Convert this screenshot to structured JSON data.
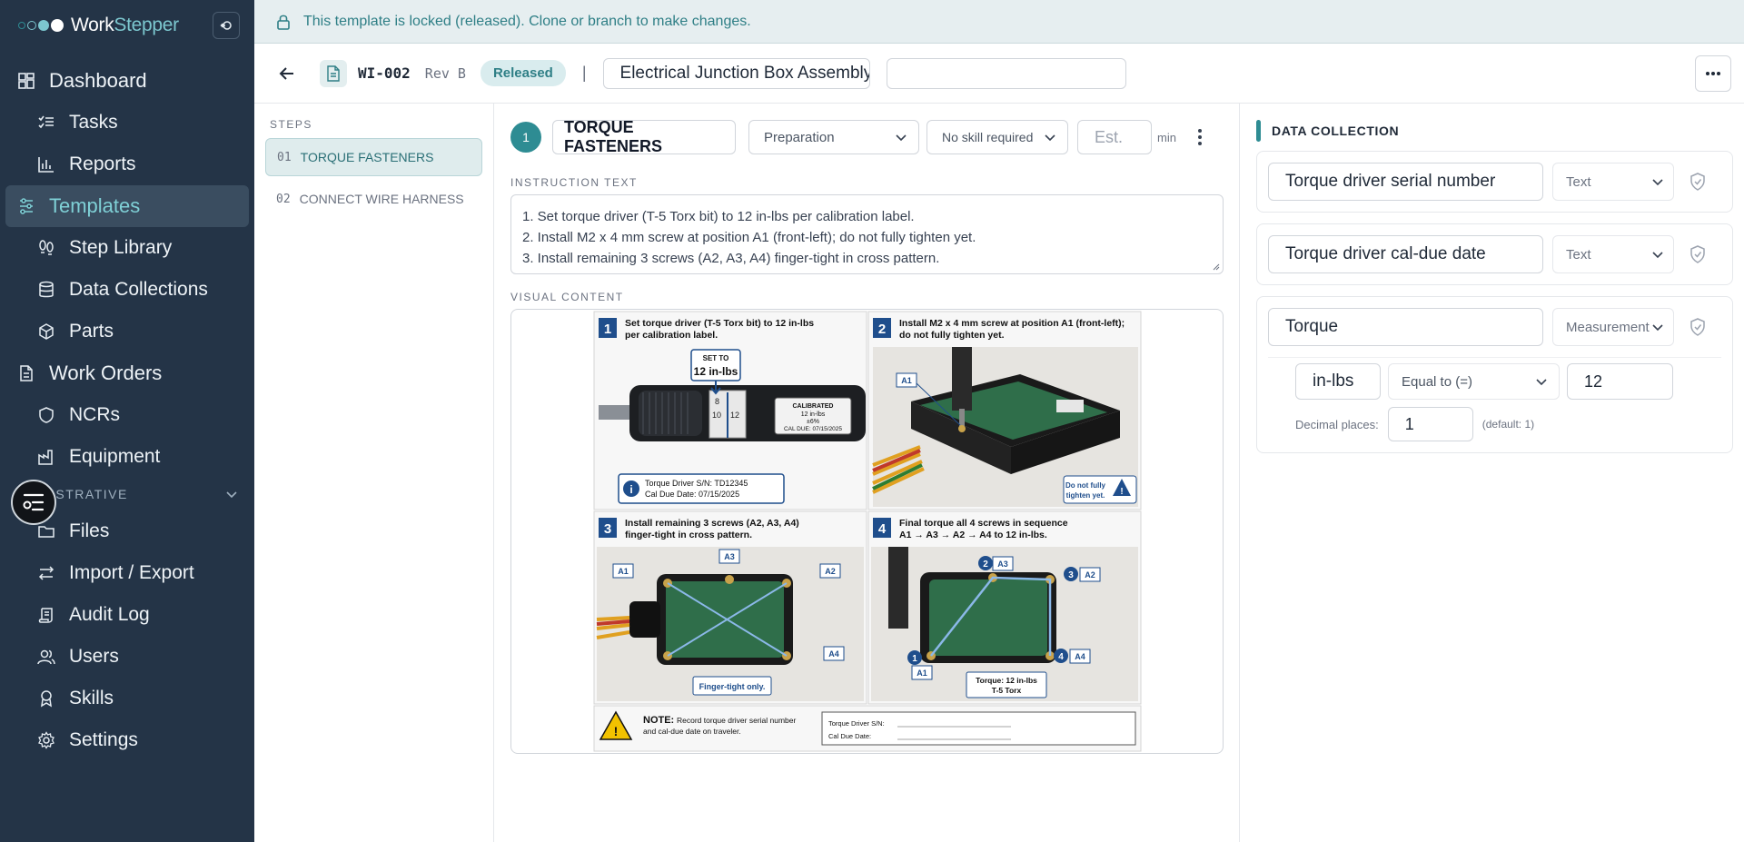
{
  "app": {
    "name_part1": "Work",
    "name_part2": "Stepper"
  },
  "sidebar": {
    "items": [
      {
        "label": "Dashboard"
      },
      {
        "label": "Tasks"
      },
      {
        "label": "Reports"
      },
      {
        "label": "Templates"
      },
      {
        "label": "Step Library"
      },
      {
        "label": "Data Collections"
      },
      {
        "label": "Parts"
      },
      {
        "label": "Work Orders"
      },
      {
        "label": "NCRs"
      },
      {
        "label": "Equipment"
      },
      {
        "label": "Files"
      },
      {
        "label": "Import / Export"
      },
      {
        "label": "Audit Log"
      },
      {
        "label": "Users"
      },
      {
        "label": "Skills"
      },
      {
        "label": "Settings"
      }
    ],
    "section_label": "ISTRATIVE",
    "active_item": "Templates"
  },
  "banner": {
    "text": "This template is locked (released). Clone or branch to make changes."
  },
  "header": {
    "wi_id": "WI-002",
    "rev": "Rev B",
    "status": "Released",
    "separator": "|",
    "title_value": "Electrical Junction Box Assembly",
    "second_field_value": ""
  },
  "steps": {
    "label": "STEPS",
    "items": [
      {
        "num": "01",
        "label": "TORQUE FASTENERS"
      },
      {
        "num": "02",
        "label": "CONNECT WIRE HARNESS"
      }
    ]
  },
  "editor": {
    "step_number": "1",
    "step_title": "TORQUE FASTENERS",
    "phase_select": "Preparation",
    "skill_select": "No skill required",
    "est_placeholder": "Est.",
    "min_label": "min",
    "instruction_label": "INSTRUCTION TEXT",
    "instruction_lines": [
      "1. Set torque driver (T-5 Torx bit) to 12 in-lbs per calibration label.",
      "2. Install M2 x 4 mm screw at position A1 (front-left); do not fully tighten yet.",
      "3. Install remaining 3 screws (A2, A3, A4) finger-tight in cross pattern."
    ],
    "visual_label": "VISUAL CONTENT"
  },
  "visual": {
    "panel1": {
      "num": "1",
      "caption1": "Set torque driver (T-5 Torx bit) to 12 in-lbs",
      "caption2": "per calibration label.",
      "set_to": "SET TO",
      "set_value": "12 in-lbs",
      "scale_8": "8",
      "scale_10": "10",
      "scale_12": "12",
      "cal_line1": "CALIBRATED",
      "cal_line2": "12 in-lbs",
      "cal_line3": "±6%",
      "cal_line4": "CAL DUE: 07/15/2025",
      "info1": "Torque Driver S/N: TD12345",
      "info2": "Cal Due Date: 07/15/2025"
    },
    "panel2": {
      "num": "2",
      "caption1": "Install M2 x 4 mm screw at position A1 (front-left);",
      "caption2": "do not fully tighten yet.",
      "a1": "A1",
      "warn1": "Do not fully",
      "warn2": "tighten yet."
    },
    "panel3": {
      "num": "3",
      "caption1": "Install remaining 3 screws (A2, A3, A4)",
      "caption2": "finger-tight in cross pattern.",
      "a1": "A1",
      "a2": "A2",
      "a3": "A3",
      "a4": "A4",
      "note": "Finger-tight only."
    },
    "panel4": {
      "num": "4",
      "caption1": "Final torque all 4 screws in sequence",
      "caption2": "A1 → A3 → A2 → A4 to 12 in-lbs.",
      "seq1": "1",
      "seq2": "2",
      "seq3": "3",
      "seq4": "4",
      "a1": "A1",
      "a2": "A2",
      "a3": "A3",
      "a4": "A4",
      "torque1": "Torque: 12 in-lbs",
      "torque2": "T-5 Torx"
    },
    "note": {
      "title": "NOTE:",
      "text1": "Record torque driver serial number",
      "text2": "and cal-due date on traveler.",
      "field1": "Torque Driver S/N:",
      "field2": "Cal Due Date:"
    }
  },
  "data_collection": {
    "title": "DATA COLLECTION",
    "fields": [
      {
        "name": "Torque driver serial number",
        "type": "Text"
      },
      {
        "name": "Torque driver cal-due date",
        "type": "Text"
      },
      {
        "name": "Torque",
        "type": "Measurement"
      }
    ],
    "measurement": {
      "unit": "in-lbs",
      "operator": "Equal to (=)",
      "value": "12",
      "decimal_label": "Decimal places:",
      "decimal_value": "1",
      "decimal_default": "(default: 1)"
    }
  },
  "colors": {
    "accent": "#2e8c93",
    "sidebar_bg": "#243447",
    "active_text": "#7fd0d6",
    "banner_bg": "#e6eef0"
  }
}
